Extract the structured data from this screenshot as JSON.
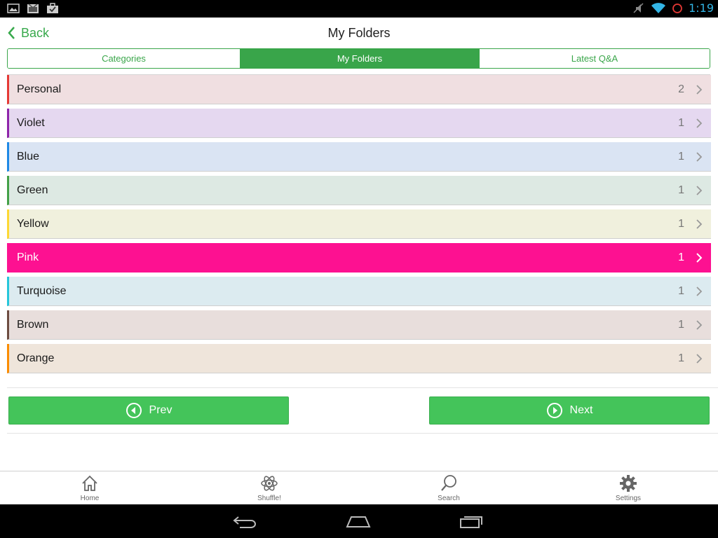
{
  "status_bar": {
    "time": "1:19",
    "left_icons": [
      "gallery-icon",
      "calendar-icon",
      "briefcase-icon"
    ],
    "right_icons": [
      "mute-icon",
      "wifi-icon",
      "sync-icon"
    ]
  },
  "header": {
    "back_label": "Back",
    "title": "My Folders"
  },
  "tabs": [
    {
      "label": "Categories",
      "active": false
    },
    {
      "label": "My Folders",
      "active": true
    },
    {
      "label": "Latest Q&A",
      "active": false
    }
  ],
  "folders": [
    {
      "label": "Personal",
      "count": "2",
      "bg": "#f0dfe1",
      "accent": "#e53935",
      "selected": false
    },
    {
      "label": "Violet",
      "count": "1",
      "bg": "#e5d8f0",
      "accent": "#8e24aa",
      "selected": false
    },
    {
      "label": "Blue",
      "count": "1",
      "bg": "#dae4f3",
      "accent": "#1e88e5",
      "selected": false
    },
    {
      "label": "Green",
      "count": "1",
      "bg": "#dde9e3",
      "accent": "#43a047",
      "selected": false
    },
    {
      "label": "Yellow",
      "count": "1",
      "bg": "#f0f0dd",
      "accent": "#fdd835",
      "selected": false
    },
    {
      "label": "Pink",
      "count": "1",
      "bg": "#fd1191",
      "accent": "#fd1191",
      "selected": true
    },
    {
      "label": "Turquoise",
      "count": "1",
      "bg": "#dcebf0",
      "accent": "#26c6da",
      "selected": false
    },
    {
      "label": "Brown",
      "count": "1",
      "bg": "#e8dedc",
      "accent": "#6d4c41",
      "selected": false
    },
    {
      "label": "Orange",
      "count": "1",
      "bg": "#efe5db",
      "accent": "#fb8c00",
      "selected": false
    }
  ],
  "pager": {
    "prev_label": "Prev",
    "next_label": "Next"
  },
  "bottom_nav": [
    {
      "label": "Home",
      "icon": "home-icon"
    },
    {
      "label": "Shuffle!",
      "icon": "atom-icon"
    },
    {
      "label": "Search",
      "icon": "search-icon"
    },
    {
      "label": "Settings",
      "icon": "gear-icon"
    }
  ],
  "system_nav": [
    "back-icon",
    "home-outline-icon",
    "recents-icon"
  ],
  "colors": {
    "accent_green": "#39a54a",
    "button_green": "#44c45a",
    "clock_blue": "#33b5e5"
  }
}
